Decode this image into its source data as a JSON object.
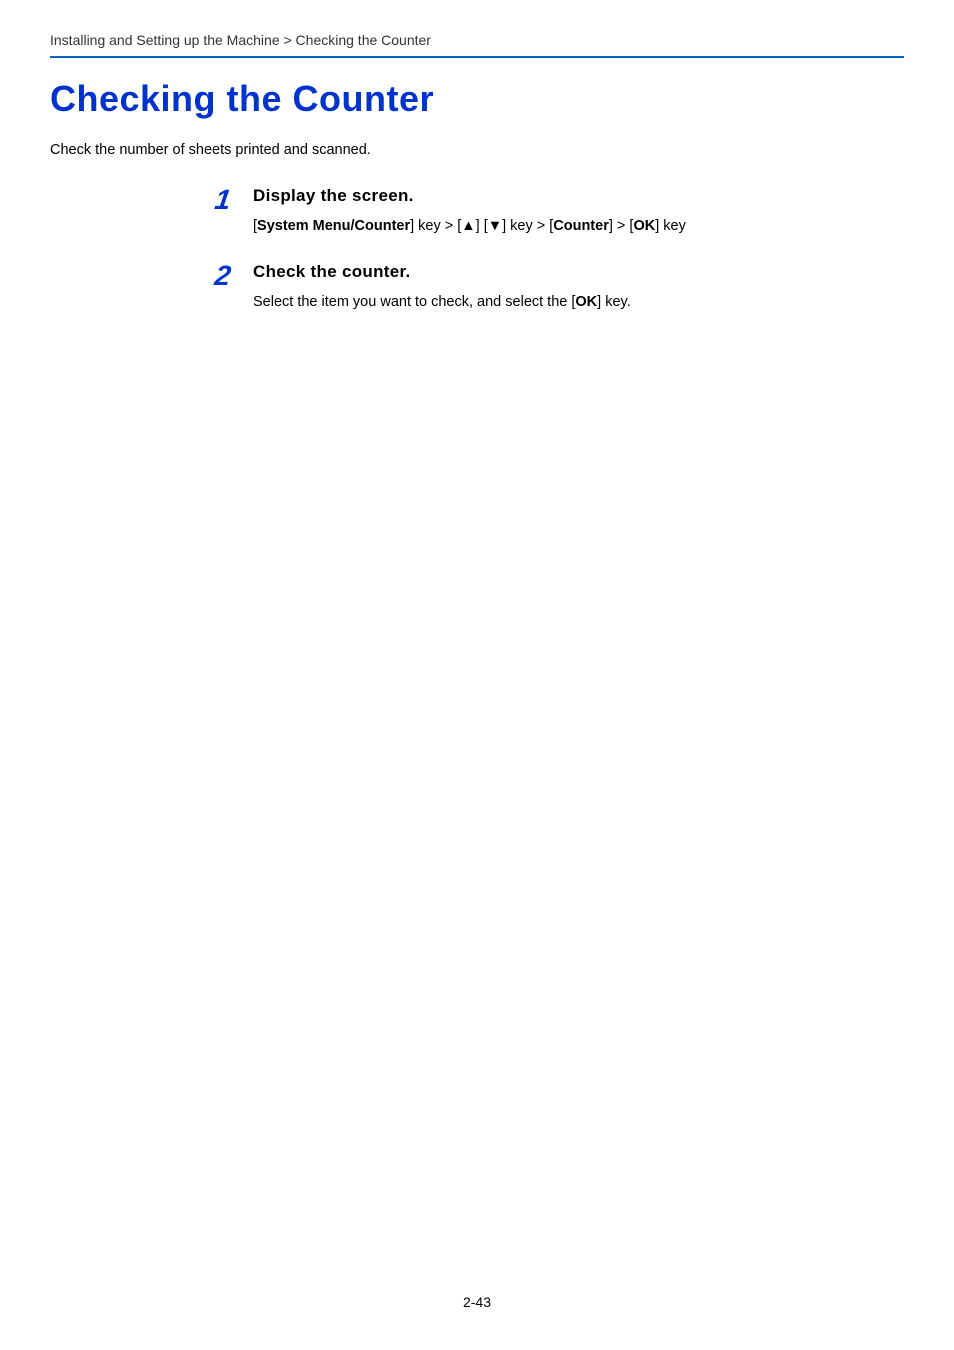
{
  "breadcrumb": "Installing and Setting up the Machine > Checking the Counter",
  "title": "Checking the Counter",
  "intro": "Check the number of sheets printed and scanned.",
  "steps": [
    {
      "number": "1",
      "heading": "Display the screen.",
      "text_parts": {
        "p1": "[",
        "b1": "System Menu/Counter",
        "p2": "] key > [▲] [▼] key > [",
        "b2": "Counter",
        "p3": "] > [",
        "b3": "OK",
        "p4": "] key"
      }
    },
    {
      "number": "2",
      "heading": "Check the counter.",
      "text_parts": {
        "p1": "Select the item you want to check, and select the [",
        "b1": "OK",
        "p2": "] key."
      }
    }
  ],
  "page_number": "2-43"
}
